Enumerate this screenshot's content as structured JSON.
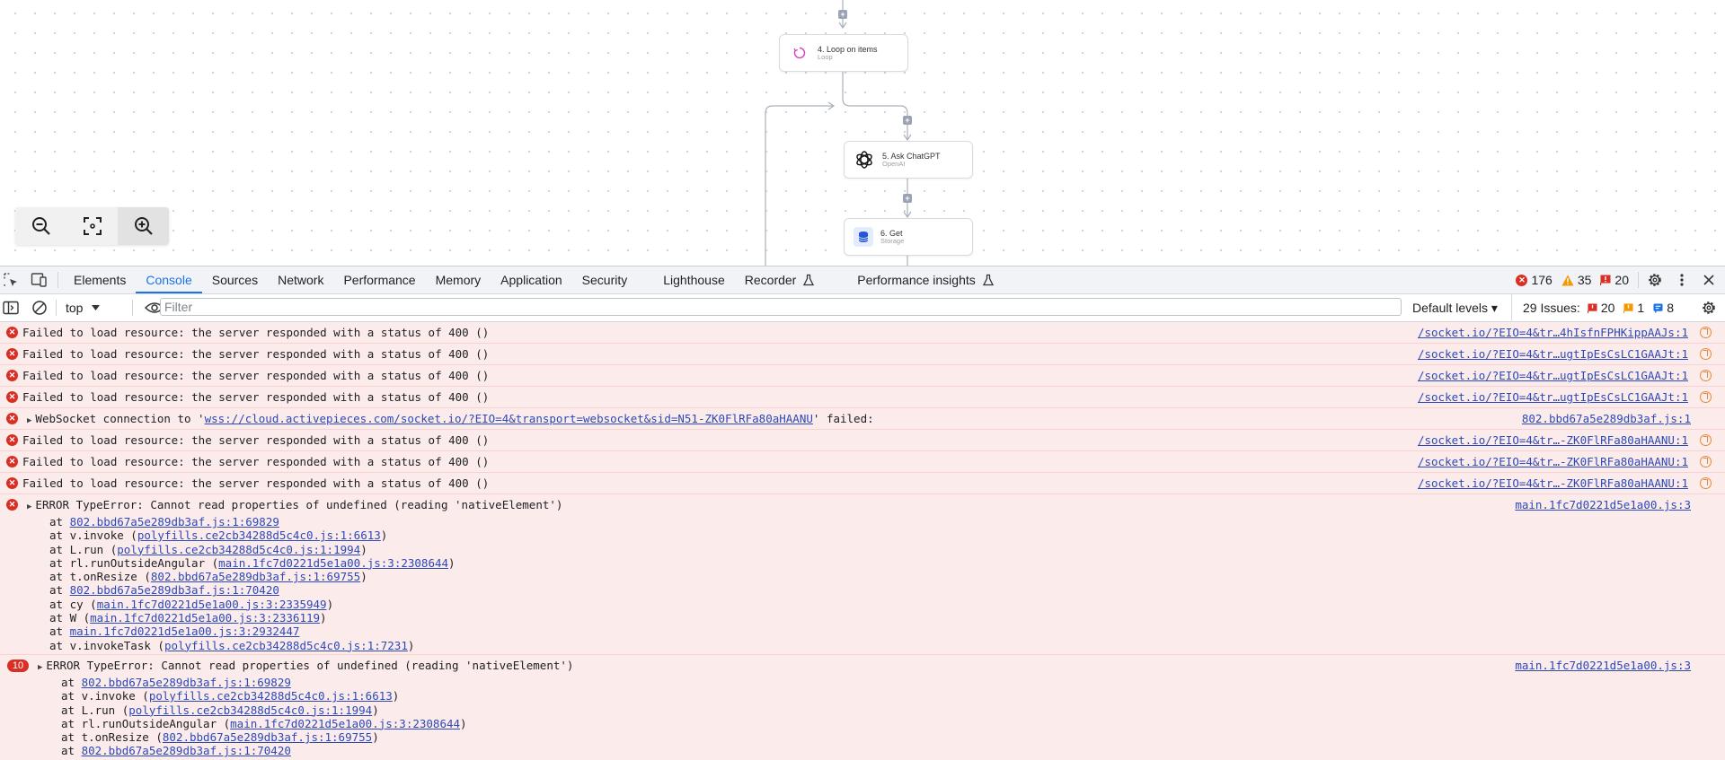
{
  "canvas": {
    "nodes": [
      {
        "title": "4. Loop on items",
        "subtitle": "Loop",
        "icon": "loop-icon"
      },
      {
        "title": "5. Ask ChatGPT",
        "subtitle": "OpenAI",
        "icon": "openai-icon"
      },
      {
        "title": "6. Get",
        "subtitle": "Storage",
        "icon": "storage-icon"
      }
    ],
    "plus_label": "+",
    "zoom_controls": [
      "zoom-out-icon",
      "fit-to-screen-icon",
      "zoom-in-icon"
    ]
  },
  "devtools": {
    "tabs": [
      "Elements",
      "Console",
      "Sources",
      "Network",
      "Performance",
      "Memory",
      "Application",
      "Security",
      "Lighthouse",
      "Recorder",
      "Performance insights"
    ],
    "active_tab": "Console",
    "counts": {
      "errors": "176",
      "warnings": "35",
      "issues": "20"
    },
    "toolbar": {
      "context": "top",
      "filter_placeholder": "Filter",
      "levels": "Default levels ▾",
      "issues_label": "29 Issues:",
      "issues_errors": "20",
      "issues_warnings": "1",
      "issues_info": "8"
    },
    "colors": {
      "error": "#d93025",
      "error_bg": "#fcebeb",
      "accent": "#1a73e8",
      "warning": "#f29900"
    }
  },
  "console": {
    "messages": [
      {
        "text": "Failed to load resource: the server responded with a status of 400 ()",
        "source": "/socket.io/?EIO=4&tr…4hIsfnFPHKippAAJs:1"
      },
      {
        "text": "Failed to load resource: the server responded with a status of 400 ()",
        "source": "/socket.io/?EIO=4&tr…ugtIpEsCsLC1GAAJt:1"
      },
      {
        "text": "Failed to load resource: the server responded with a status of 400 ()",
        "source": "/socket.io/?EIO=4&tr…ugtIpEsCsLC1GAAJt:1"
      },
      {
        "text": "Failed to load resource: the server responded with a status of 400 ()",
        "source": "/socket.io/?EIO=4&tr…ugtIpEsCsLC1GAAJt:1"
      },
      {
        "prefix": "WebSocket connection to '",
        "link": "wss://cloud.activepieces.com/socket.io/?EIO=4&transport=websocket&sid=N51-ZK0FlRFa80aHAANU",
        "suffix": "' failed:",
        "source": "802.bbd67a5e289db3af.js:1"
      },
      {
        "text": "Failed to load resource: the server responded with a status of 400 ()",
        "source": "/socket.io/?EIO=4&tr…-ZK0FlRFa80aHAANU:1"
      },
      {
        "text": "Failed to load resource: the server responded with a status of 400 ()",
        "source": "/socket.io/?EIO=4&tr…-ZK0FlRFa80aHAANU:1"
      },
      {
        "text": "Failed to load resource: the server responded with a status of 400 ()",
        "source": "/socket.io/?EIO=4&tr…-ZK0FlRFa80aHAANU:1"
      }
    ],
    "error_groups": [
      {
        "count": "",
        "text": "ERROR TypeError: Cannot read properties of undefined (reading 'nativeElement')",
        "source": "main.1fc7d0221d5e1a00.js:3",
        "frames": [
          {
            "fn": "at ",
            "link": "802.bbd67a5e289db3af.js:1:69829",
            "close": ""
          },
          {
            "fn": "at v.invoke (",
            "link": "polyfills.ce2cb34288d5c4c0.js:1:6613",
            "close": ")"
          },
          {
            "fn": "at L.run (",
            "link": "polyfills.ce2cb34288d5c4c0.js:1:1994",
            "close": ")"
          },
          {
            "fn": "at rl.runOutsideAngular (",
            "link": "main.1fc7d0221d5e1a00.js:3:2308644",
            "close": ")"
          },
          {
            "fn": "at t.onResize (",
            "link": "802.bbd67a5e289db3af.js:1:69755",
            "close": ")"
          },
          {
            "fn": "at ",
            "link": "802.bbd67a5e289db3af.js:1:70420",
            "close": ""
          },
          {
            "fn": "at cy (",
            "link": "main.1fc7d0221d5e1a00.js:3:2335949",
            "close": ")"
          },
          {
            "fn": "at W (",
            "link": "main.1fc7d0221d5e1a00.js:3:2336119",
            "close": ")"
          },
          {
            "fn": "at ",
            "link": "main.1fc7d0221d5e1a00.js:3:2932447",
            "close": ""
          },
          {
            "fn": "at v.invokeTask (",
            "link": "polyfills.ce2cb34288d5c4c0.js:1:7231",
            "close": ")"
          }
        ]
      },
      {
        "count": "10",
        "text": "ERROR TypeError: Cannot read properties of undefined (reading 'nativeElement')",
        "source": "main.1fc7d0221d5e1a00.js:3",
        "frames": [
          {
            "fn": "at ",
            "link": "802.bbd67a5e289db3af.js:1:69829",
            "close": ""
          },
          {
            "fn": "at v.invoke (",
            "link": "polyfills.ce2cb34288d5c4c0.js:1:6613",
            "close": ")"
          },
          {
            "fn": "at L.run (",
            "link": "polyfills.ce2cb34288d5c4c0.js:1:1994",
            "close": ")"
          },
          {
            "fn": "at rl.runOutsideAngular (",
            "link": "main.1fc7d0221d5e1a00.js:3:2308644",
            "close": ")"
          },
          {
            "fn": "at t.onResize (",
            "link": "802.bbd67a5e289db3af.js:1:69755",
            "close": ")"
          },
          {
            "fn": "at ",
            "link": "802.bbd67a5e289db3af.js:1:70420",
            "close": ""
          }
        ]
      }
    ]
  }
}
